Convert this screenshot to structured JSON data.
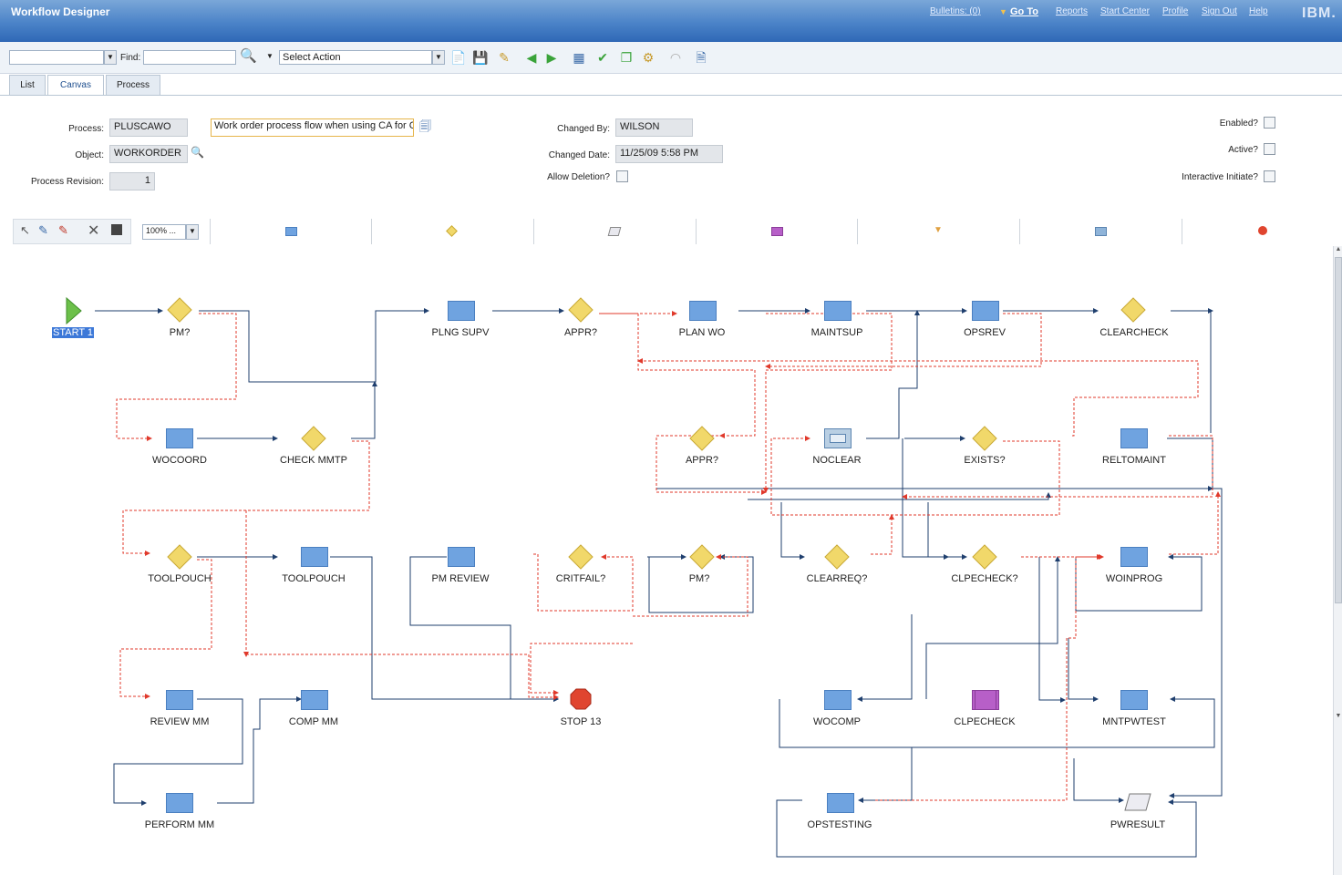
{
  "app": {
    "title": "Workflow Designer",
    "nav": {
      "bulletins": "Bulletins: (0)",
      "goto": "Go To",
      "reports": "Reports",
      "start_center": "Start Center",
      "profile": "Profile",
      "sign_out": "Sign Out",
      "help": "Help"
    },
    "logo": "IBM."
  },
  "toolbar": {
    "find_label": "Find:",
    "find_value": "",
    "action_select": "Select Action"
  },
  "tabs": [
    {
      "label": "List"
    },
    {
      "label": "Canvas",
      "active": true
    },
    {
      "label": "Process"
    }
  ],
  "form": {
    "process_label": "Process:",
    "process_value": "PLUSCAWO",
    "description": "Work order process flow when using CA for Ca",
    "object_label": "Object:",
    "object_value": "WORKORDER",
    "revision_label": "Process Revision:",
    "revision_value": "1",
    "changed_by_label": "Changed By:",
    "changed_by_value": "WILSON",
    "changed_date_label": "Changed Date:",
    "changed_date_value": "11/25/09 5:58 PM",
    "allow_deletion_label": "Allow Deletion?",
    "enabled_label": "Enabled?",
    "active_label": "Active?",
    "interactive_label": "Interactive Initiate?"
  },
  "palette": {
    "zoom": "100% ..."
  },
  "nodes": [
    {
      "id": "start1",
      "label": "START 1",
      "type": "start"
    },
    {
      "id": "pm1",
      "label": "PM?",
      "type": "condition"
    },
    {
      "id": "plngsupv",
      "label": "PLNG SUPV",
      "type": "task"
    },
    {
      "id": "appr1",
      "label": "APPR?",
      "type": "condition"
    },
    {
      "id": "planwo",
      "label": "PLAN WO",
      "type": "task"
    },
    {
      "id": "maintsup",
      "label": "MAINTSUP",
      "type": "task"
    },
    {
      "id": "opsrev",
      "label": "OPSREV",
      "type": "task"
    },
    {
      "id": "clearcheck",
      "label": "CLEARCHECK",
      "type": "condition"
    },
    {
      "id": "wocoord",
      "label": "WOCOORD",
      "type": "task"
    },
    {
      "id": "checkmmtp",
      "label": "CHECK MMTP",
      "type": "condition"
    },
    {
      "id": "appr2",
      "label": "APPR?",
      "type": "condition"
    },
    {
      "id": "noclear",
      "label": "NOCLEAR",
      "type": "wait"
    },
    {
      "id": "exists",
      "label": "EXISTS?",
      "type": "condition"
    },
    {
      "id": "reltomaint",
      "label": "RELTOMAINT",
      "type": "task"
    },
    {
      "id": "toolpouch1",
      "label": "TOOLPOUCH",
      "type": "condition"
    },
    {
      "id": "toolpouch2",
      "label": "TOOLPOUCH",
      "type": "task"
    },
    {
      "id": "pmreview",
      "label": "PM REVIEW",
      "type": "task"
    },
    {
      "id": "critfail",
      "label": "CRITFAIL?",
      "type": "condition"
    },
    {
      "id": "pm2",
      "label": "PM?",
      "type": "condition"
    },
    {
      "id": "clearreq",
      "label": "CLEARREQ?",
      "type": "condition"
    },
    {
      "id": "clpecheckq",
      "label": "CLPECHECK?",
      "type": "condition"
    },
    {
      "id": "woinprog",
      "label": "WOINPROG",
      "type": "task"
    },
    {
      "id": "reviewmm",
      "label": "REVIEW MM",
      "type": "task"
    },
    {
      "id": "compmm",
      "label": "COMP MM",
      "type": "task"
    },
    {
      "id": "stop13",
      "label": "STOP 13",
      "type": "stop"
    },
    {
      "id": "wocomp",
      "label": "WOCOMP",
      "type": "task"
    },
    {
      "id": "clpecheck",
      "label": "CLPECHECK",
      "type": "subprocess"
    },
    {
      "id": "mntpwtest",
      "label": "MNTPWTEST",
      "type": "task"
    },
    {
      "id": "performmm",
      "label": "PERFORM MM",
      "type": "task"
    },
    {
      "id": "opstesting",
      "label": "OPSTESTING",
      "type": "task"
    },
    {
      "id": "pwresult",
      "label": "PWRESULT",
      "type": "manual"
    }
  ],
  "colors": {
    "positive_line": "#1f3f6e",
    "negative_line": "#e0392b",
    "task_fill": "#6fa3e0",
    "condition_fill": "#f1d86a",
    "start_fill": "#6cc04a",
    "stop_fill": "#e0452f",
    "subprocess_fill": "#b75fc8"
  }
}
